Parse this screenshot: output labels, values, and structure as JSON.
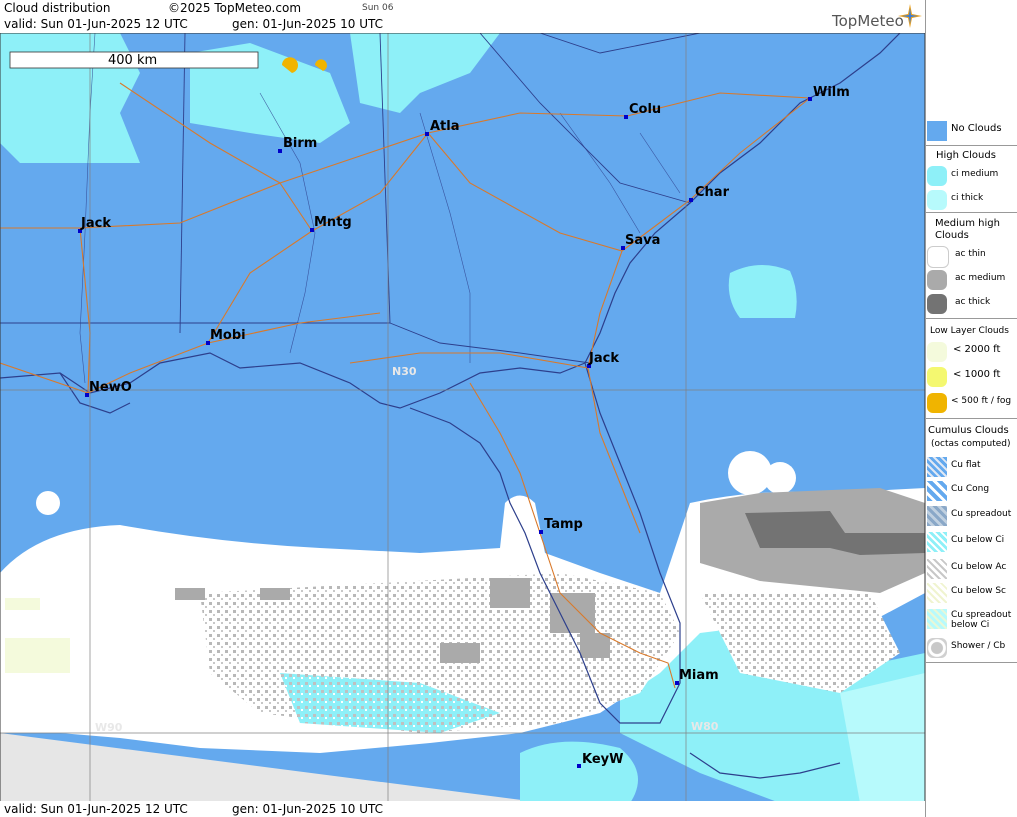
{
  "header": {
    "title": "Cloud distribution",
    "copyright": "©2025 TopMeteo.com",
    "day_tab": "Sun 06",
    "valid_line": "valid:  Sun  01-Jun-2025  12 UTC",
    "gen_line": "gen:  01-Jun-2025 10 UTC",
    "brand": "TopMeteo"
  },
  "footer": {
    "valid_line": "valid:  Sun  01-Jun-2025  12 UTC",
    "gen_line": "gen:  01-Jun-2025 10 UTC"
  },
  "map": {
    "scale_label": "400 km",
    "grid_labels": {
      "lat": "N30",
      "lon_a": "W90",
      "lon_b": "W80"
    },
    "cities": [
      {
        "name": "Wilm"
      },
      {
        "name": "Colu"
      },
      {
        "name": "Atla"
      },
      {
        "name": "Birm"
      },
      {
        "name": "Char"
      },
      {
        "name": "Jack"
      },
      {
        "name": "Mntg"
      },
      {
        "name": "Sava"
      },
      {
        "name": "Mobi"
      },
      {
        "name": "Jack"
      },
      {
        "name": "NewO"
      },
      {
        "name": "Tamp"
      },
      {
        "name": "Miam"
      },
      {
        "name": "KeyW"
      }
    ],
    "colors": {
      "no_clouds": "#64a9ee",
      "ci_medium": "#8ef0f8",
      "ci_thick": "#b7fafc",
      "ac_thin": "#ffffff",
      "ac_medium": "#aaaaaa",
      "ac_thick": "#737373",
      "fog": "#f0b400",
      "outside": "#e6e6e6",
      "roads": "#d9792a",
      "borders": "#2d3f8c"
    }
  },
  "legend": {
    "no_clouds": "No Clouds",
    "high_title": "High Clouds",
    "high": [
      "ci medium",
      "ci thick"
    ],
    "medium_title": "Medium high Clouds",
    "medium": [
      "ac thin",
      "ac medium",
      "ac thick"
    ],
    "low_title": "Low Layer Clouds",
    "low": [
      "< 2000 ft",
      "< 1000 ft",
      "< 500 ft / fog"
    ],
    "cumulus_title": "Cumulus Clouds",
    "cumulus_sub": "(octas computed)",
    "cumulus": [
      "Cu flat",
      "Cu Cong",
      "Cu spreadout",
      "Cu below Ci",
      "Cu below Ac",
      "Cu below Sc",
      "Cu spreadout below Ci",
      "Shower / Cb"
    ]
  }
}
